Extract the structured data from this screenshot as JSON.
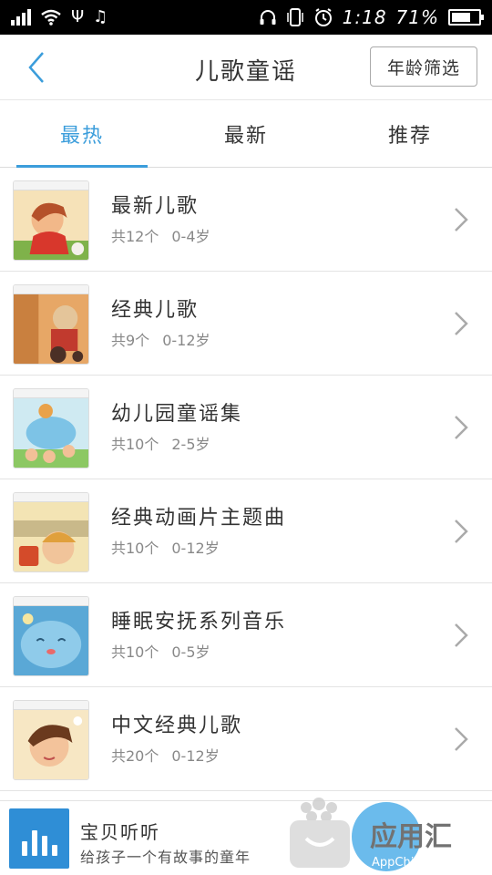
{
  "status_bar": {
    "time": "1:18",
    "battery": "71%",
    "usb_glyph": "Ψ",
    "music_glyph": "♫",
    "headphone_glyph": "🎧",
    "alarm_glyph": "⏰",
    "battery_level": 0.71
  },
  "header": {
    "title": "儿歌童谣",
    "filter_label": "年龄筛选",
    "back_icon": "chevron-left-icon"
  },
  "tabs": [
    {
      "label": "最热",
      "active": true
    },
    {
      "label": "最新",
      "active": false
    },
    {
      "label": "推荐",
      "active": false
    }
  ],
  "albums": [
    {
      "title": "最新儿歌",
      "count": "共12个",
      "age": "0-4岁"
    },
    {
      "title": "经典儿歌",
      "count": "共9个",
      "age": "0-12岁"
    },
    {
      "title": "幼儿园童谣集",
      "count": "共10个",
      "age": "2-5岁"
    },
    {
      "title": "经典动画片主题曲",
      "count": "共10个",
      "age": "0-12岁"
    },
    {
      "title": "睡眠安抚系列音乐",
      "count": "共10个",
      "age": "0-5岁"
    },
    {
      "title": "中文经典儿歌",
      "count": "共20个",
      "age": "0-12岁"
    }
  ],
  "banner": {
    "title": "宝贝听听",
    "subtitle": "给孩子一个有故事的童年"
  },
  "watermark": {
    "text": "应用汇",
    "domain": "AppChina.com"
  },
  "colors": {
    "accent": "#3b9ddb",
    "banner_logo": "#2f8ed6"
  }
}
